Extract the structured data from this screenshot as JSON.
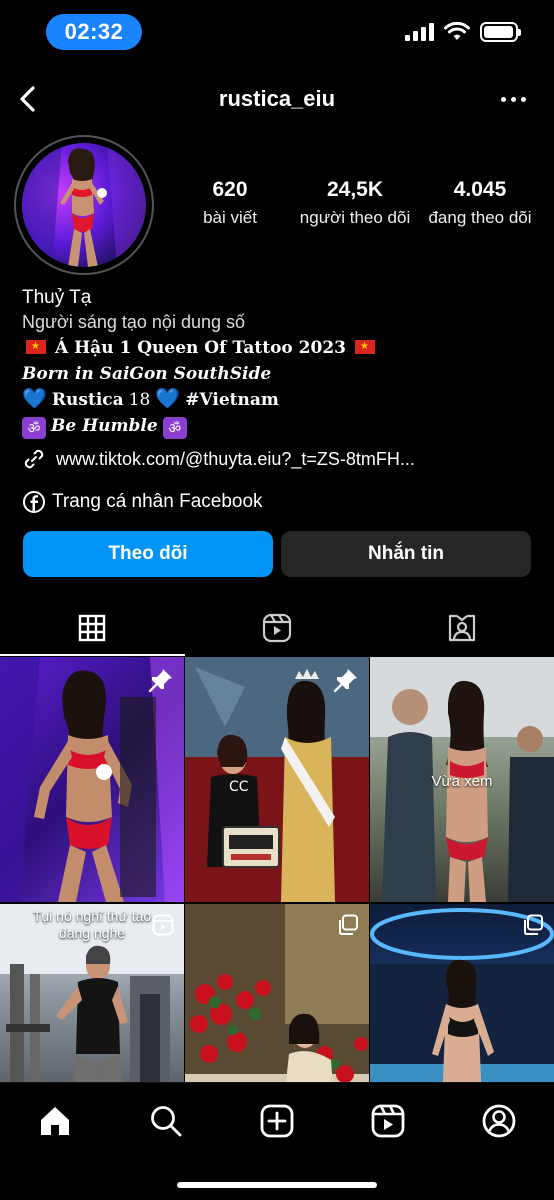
{
  "status_bar": {
    "time": "02:32",
    "battery_level": 0.95
  },
  "header": {
    "username": "rustica_eiu"
  },
  "stats": [
    {
      "value": "620",
      "label": "bài viết"
    },
    {
      "value": "24,5K",
      "label": "người theo dõi"
    },
    {
      "value": "4.045",
      "label": "đang theo dõi"
    }
  ],
  "bio": {
    "name": "Thuỷ Tạ",
    "category": "Người sáng tạo nội dung số",
    "line1": "𝐀́ 𝐇𝐚̣̂𝐮 𝟏 𝐐𝐮𝐞𝐞𝐧 𝐎𝐟 𝐓𝐚𝐭𝐭𝐨𝐨 𝟐𝟎𝟐𝟑",
    "line1_plain": "Á Hậu 1 Queen Of Tattoo 2023",
    "line2": "Born in SaiGon SouthSide",
    "line3_a": "Rustica",
    "line3_num": "18",
    "line3_b": "#Vietnam",
    "line4": "Be Humble",
    "link": "www.tiktok.com/@thuyta.eiu?_t=ZS-8tmFH...",
    "facebook": "Trang cá nhân Facebook"
  },
  "actions": {
    "follow": "Theo dõi",
    "message": "Nhắn tin"
  },
  "tabs": [
    {
      "icon": "grid-icon",
      "active": true
    },
    {
      "icon": "reels-icon",
      "active": false
    },
    {
      "icon": "tagged-icon",
      "active": false
    }
  ],
  "posts": [
    {
      "overlay": "pin-icon",
      "caption": ""
    },
    {
      "overlay": "pin-icon",
      "caption": ""
    },
    {
      "overlay": "",
      "caption": "Vừa xem"
    },
    {
      "overlay": "reel-icon",
      "caption": "Tụi nó nghĩ thứ tao đang nghe"
    },
    {
      "overlay": "multi-icon",
      "caption": ""
    },
    {
      "overlay": "multi-icon",
      "caption": ""
    }
  ],
  "colors": {
    "follow_button": "#0095f6",
    "message_button": "#262626",
    "time_pill": "#1a84ff"
  }
}
